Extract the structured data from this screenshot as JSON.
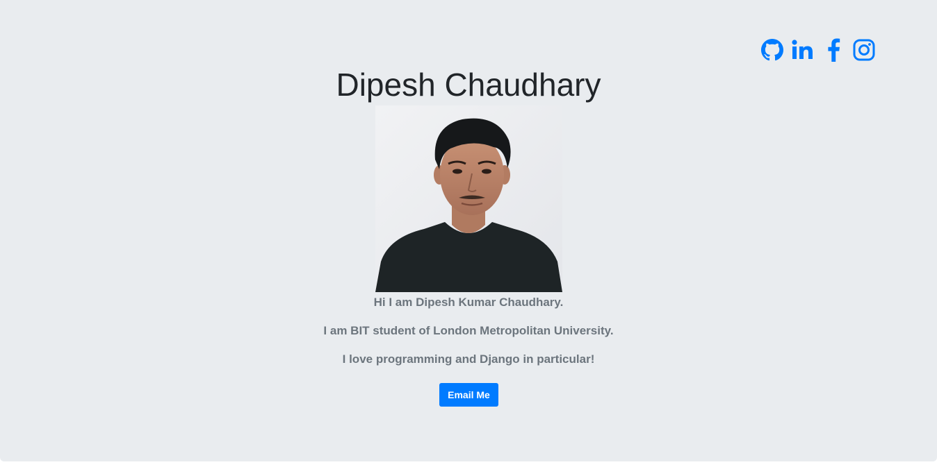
{
  "profile": {
    "name": "Dipesh Chaudhary",
    "photo_alt": "profile-photo"
  },
  "social": [
    {
      "icon": "github-icon",
      "label": "GitHub"
    },
    {
      "icon": "linkedin-icon",
      "label": "LinkedIn"
    },
    {
      "icon": "facebook-icon",
      "label": "Facebook"
    },
    {
      "icon": "instagram-icon",
      "label": "Instagram"
    }
  ],
  "bio": {
    "line1": "Hi I am Dipesh Kumar Chaudhary.",
    "line2": "I am BIT student of London Metropolitan University.",
    "line3": "I love programming and Django in particular!"
  },
  "actions": {
    "email_label": "Email Me"
  },
  "colors": {
    "accent": "#007bff",
    "background": "#e9ecef",
    "heading": "#212529",
    "muted": "#6c757d"
  }
}
